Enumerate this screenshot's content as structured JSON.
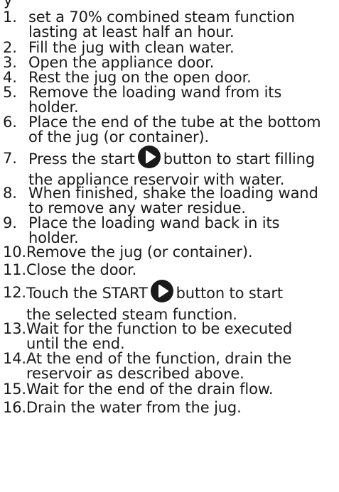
{
  "fragment": "y",
  "steps": [
    {
      "num": "1.",
      "lines": [
        "set a 70% combined steam function",
        "lasting at least half an hour."
      ]
    },
    {
      "num": "2.",
      "lines": [
        "Fill the jug with clean water."
      ]
    },
    {
      "num": "3.",
      "lines": [
        "Open the appliance door."
      ]
    },
    {
      "num": "4.",
      "lines": [
        "Rest the jug on the open door."
      ]
    },
    {
      "num": "5.",
      "lines": [
        "Remove the loading wand from its",
        "holder."
      ]
    },
    {
      "num": "6.",
      "lines": [
        "Place the end of the tube at the bottom",
        "of the jug (or container)."
      ]
    },
    {
      "num": "7.",
      "before_icon": "Press the start",
      "after_icon": "button to start filling",
      "lines": [
        "the appliance reservoir with water."
      ]
    },
    {
      "num": "8.",
      "lines": [
        "When finished, shake the loading wand",
        "to remove any water residue."
      ]
    },
    {
      "num": "9.",
      "lines": [
        "Place the loading wand back in its",
        "holder."
      ]
    },
    {
      "num": "10.",
      "lines": [
        "Remove the jug (or container)."
      ]
    },
    {
      "num": "11.",
      "lines": [
        "Close the door."
      ]
    },
    {
      "num": "12.",
      "before_icon": "Touch the START",
      "after_icon": "button to start",
      "lines": [
        "the selected steam function."
      ]
    },
    {
      "num": "13.",
      "lines": [
        "Wait for the function to be executed",
        "until the end."
      ]
    },
    {
      "num": "14.",
      "lines": [
        "At the end of the function, drain the",
        "reservoir as described above."
      ]
    },
    {
      "num": "15.",
      "lines": [
        "Wait for the end of the drain flow."
      ]
    },
    {
      "num": "16.",
      "lines": [
        "Drain the water from the jug."
      ]
    }
  ],
  "icons": {
    "play": "play-icon",
    "color": "#1a1a1a"
  }
}
